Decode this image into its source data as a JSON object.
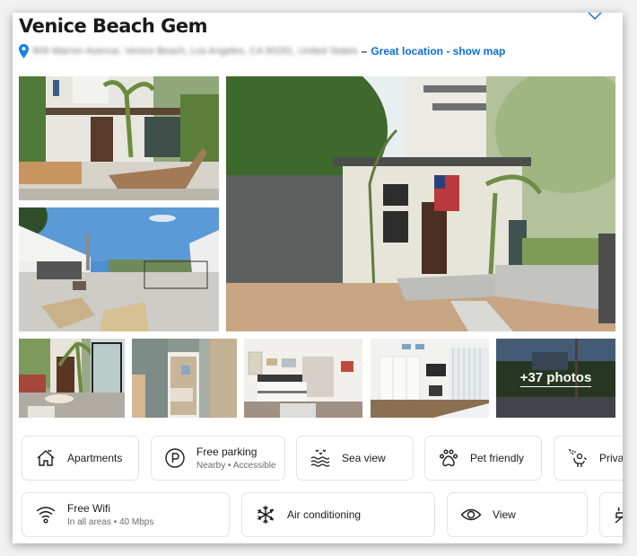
{
  "listing": {
    "title": "Venice Beach Gem",
    "address": "909 Warren Avenue, Venice Beach, Los Angeles, CA 90291, United States",
    "address_separator": "–",
    "map_link": "Great location - show map"
  },
  "gallery": {
    "more_photos_label": "+37 photos",
    "photos": [
      {
        "name": "exterior-patio",
        "alt": "Front patio with lounge chair"
      },
      {
        "name": "rooftop-deck",
        "alt": "Rooftop deck with loungers"
      },
      {
        "name": "main-exterior",
        "alt": "House front with flag"
      },
      {
        "name": "side-patio",
        "alt": "Side patio with table"
      },
      {
        "name": "hallway",
        "alt": "Hallway to bedroom"
      },
      {
        "name": "bedroom",
        "alt": "Bedroom with bed"
      },
      {
        "name": "living-room",
        "alt": "Living room"
      },
      {
        "name": "street-view",
        "alt": "Street view"
      }
    ]
  },
  "facilities": [
    {
      "icon": "apartment-icon",
      "label": "Apartments",
      "sub": null
    },
    {
      "icon": "parking-icon",
      "label": "Free parking",
      "sub": "Nearby • Accessible"
    },
    {
      "icon": "sea-view-icon",
      "label": "Sea view",
      "sub": null
    },
    {
      "icon": "pet-paw-icon",
      "label": "Pet friendly",
      "sub": null
    },
    {
      "icon": "private-icon",
      "label": "Private",
      "sub": null
    },
    {
      "icon": "wifi-icon",
      "label": "Free Wifi",
      "sub": "In all areas • 40 Mbps"
    },
    {
      "icon": "snowflake-icon",
      "label": "Air conditioning",
      "sub": null
    },
    {
      "icon": "eye-icon",
      "label": "View",
      "sub": null
    },
    {
      "icon": "no-smoking-icon",
      "label": "",
      "sub": null
    }
  ],
  "colors": {
    "link": "#0b6ed6",
    "pin": "#1a7fe0",
    "text": "#1a1a1a"
  }
}
